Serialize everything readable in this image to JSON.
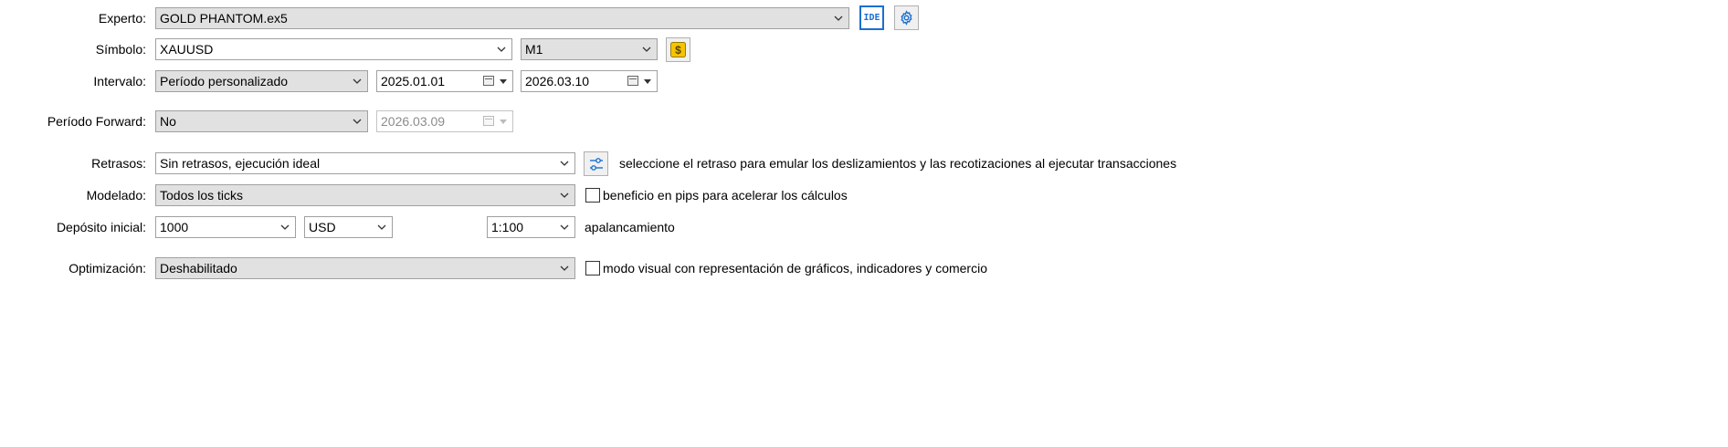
{
  "experto": {
    "label": "Experto:",
    "value": "GOLD PHANTOM.ex5",
    "ide_label": "IDE",
    "settings_icon": "gear-icon"
  },
  "simbolo": {
    "label": "Símbolo:",
    "value": "XAUUSD",
    "timeframe": "M1",
    "symbol_icon": "dollar-icon"
  },
  "intervalo": {
    "label": "Intervalo:",
    "value": "Período personalizado",
    "from": "2025.01.01",
    "to": "2026.03.10"
  },
  "forward": {
    "label": "Período Forward:",
    "value": "No",
    "date": "2026.03.09"
  },
  "retrasos": {
    "label": "Retrasos:",
    "value": "Sin retrasos, ejecución ideal",
    "settings_icon": "sliders-icon",
    "hint": "seleccione el retraso para emular los deslizamientos y las recotizaciones al ejecutar transacciones"
  },
  "modelado": {
    "label": "Modelado:",
    "value": "Todos los ticks",
    "checkbox_label": "beneficio en pips para acelerar los cálculos",
    "checked": false
  },
  "deposito": {
    "label": "Depósito inicial:",
    "value": "1000",
    "currency": "USD",
    "leverage": "1:100",
    "leverage_label": "apalancamiento"
  },
  "optimizacion": {
    "label": "Optimización:",
    "value": "Deshabilitado",
    "checkbox_label": "modo visual con representación de gráficos, indicadores y comercio",
    "checked": false
  }
}
